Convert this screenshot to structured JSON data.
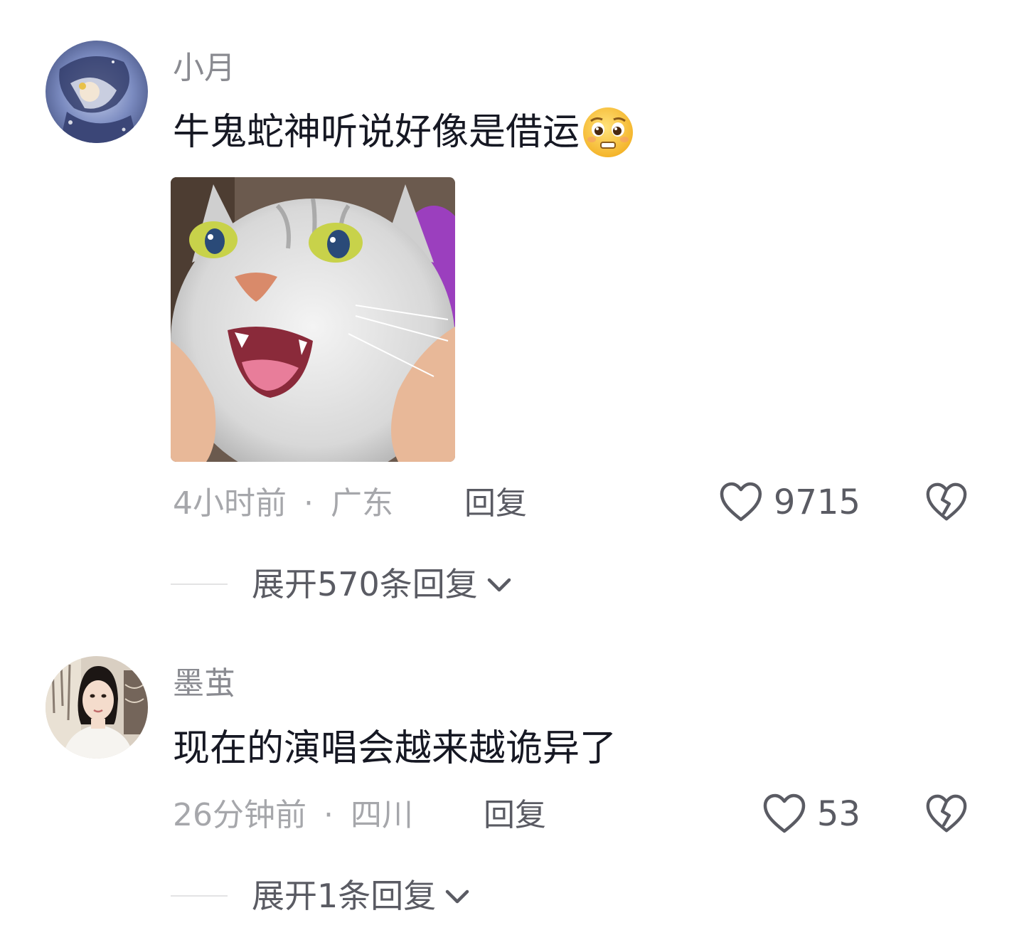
{
  "comments": [
    {
      "username": "小月",
      "text": "牛鬼蛇神听说好像是借运",
      "emoji": "pleading-face-emoji",
      "has_image": true,
      "image": "shocked-cat-meme",
      "time": "4小时前",
      "separator": "·",
      "location": "广东",
      "reply_label": "回复",
      "likes": "9715",
      "expand_label": "展开570条回复",
      "icons": {
        "like": "heart-outline-icon",
        "dislike": "broken-heart-icon",
        "expand": "chevron-down-icon"
      }
    },
    {
      "username": "墨茧",
      "text": "现在的演唱会越来越诡异了",
      "has_image": false,
      "time": "26分钟前",
      "separator": "·",
      "location": "四川",
      "reply_label": "回复",
      "likes": "53",
      "expand_label": "展开1条回复",
      "icons": {
        "like": "heart-outline-icon",
        "dislike": "broken-heart-icon",
        "expand": "chevron-down-icon"
      }
    }
  ],
  "colors": {
    "primary_text": "#161823",
    "secondary_text": "#8a8b91",
    "meta_text": "#a6a7ab",
    "action_text": "#5a5b63",
    "divider": "#e3e3e4"
  }
}
